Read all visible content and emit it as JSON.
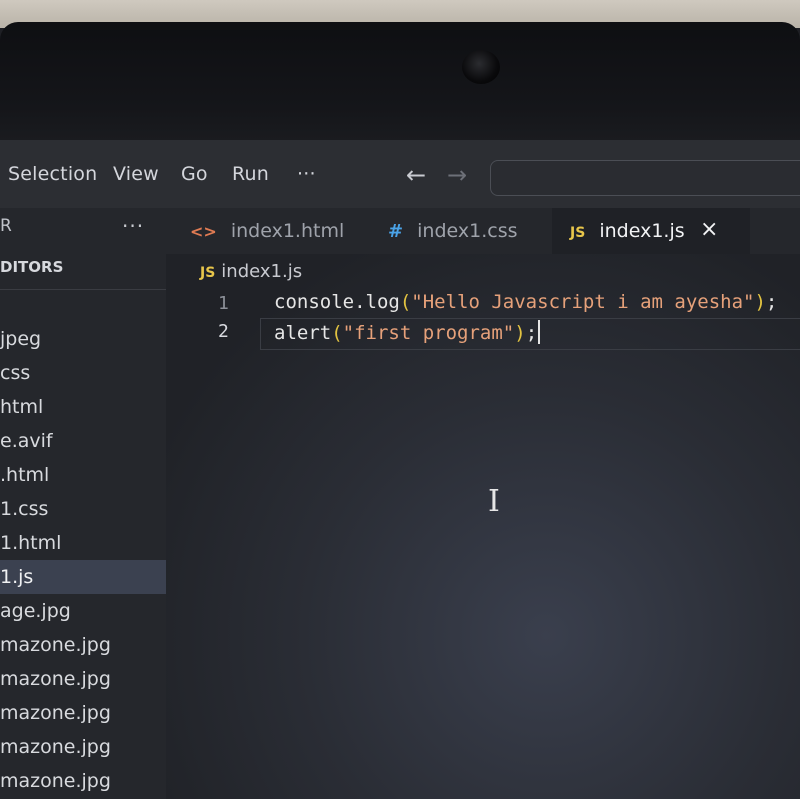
{
  "menubar": {
    "items": [
      {
        "id": "selection",
        "label": "Selection"
      },
      {
        "id": "view",
        "label": "View"
      },
      {
        "id": "go",
        "label": "Go"
      },
      {
        "id": "run",
        "label": "Run"
      },
      {
        "id": "more",
        "label": "···"
      }
    ],
    "back_icon": "arrow-left-icon",
    "forward_icon": "arrow-right-icon"
  },
  "sidebar": {
    "header_label": "R",
    "more_label": "···",
    "section_label": "DITORS",
    "files": [
      {
        "label": "jpeg",
        "active": false
      },
      {
        "label": "css",
        "active": false
      },
      {
        "label": "html",
        "active": false
      },
      {
        "label": "e.avif",
        "active": false
      },
      {
        "label": ".html",
        "active": false
      },
      {
        "label": "1.css",
        "active": false
      },
      {
        "label": "1.html",
        "active": false
      },
      {
        "label": "1.js",
        "active": true
      },
      {
        "label": "age.jpg",
        "active": false
      },
      {
        "label": "mazone.jpg",
        "active": false
      },
      {
        "label": "mazone.jpg",
        "active": false
      },
      {
        "label": "mazone.jpg",
        "active": false
      },
      {
        "label": "mazone.jpg",
        "active": false
      },
      {
        "label": "mazone.jpg",
        "active": false
      }
    ]
  },
  "tabs": [
    {
      "label": "index1.html",
      "icon_glyph": "<>",
      "icon": "html-file-icon",
      "active": false
    },
    {
      "label": "index1.css",
      "icon_glyph": "#",
      "icon": "css-file-icon",
      "active": false
    },
    {
      "label": "index1.js",
      "icon_glyph": "JS",
      "icon": "js-file-icon",
      "active": true
    }
  ],
  "tab_close": "×",
  "breadcrumb": {
    "icon_glyph": "JS",
    "label": "index1.js"
  },
  "editor": {
    "line_numbers": [
      "1",
      "2"
    ],
    "lines": [
      {
        "fn": "console.log",
        "arg": "\"Hello Javascript i am ayesha\""
      },
      {
        "fn": "alert",
        "arg": "\"first program\""
      }
    ],
    "open_paren": "(",
    "close_paren": ")",
    "terminator": ";"
  },
  "colors": {
    "string": "#e6a17a",
    "paren": "#e2c341",
    "js_icon": "#e8c64b",
    "css_icon": "#4aa3e8",
    "html_icon": "#e07b53"
  }
}
